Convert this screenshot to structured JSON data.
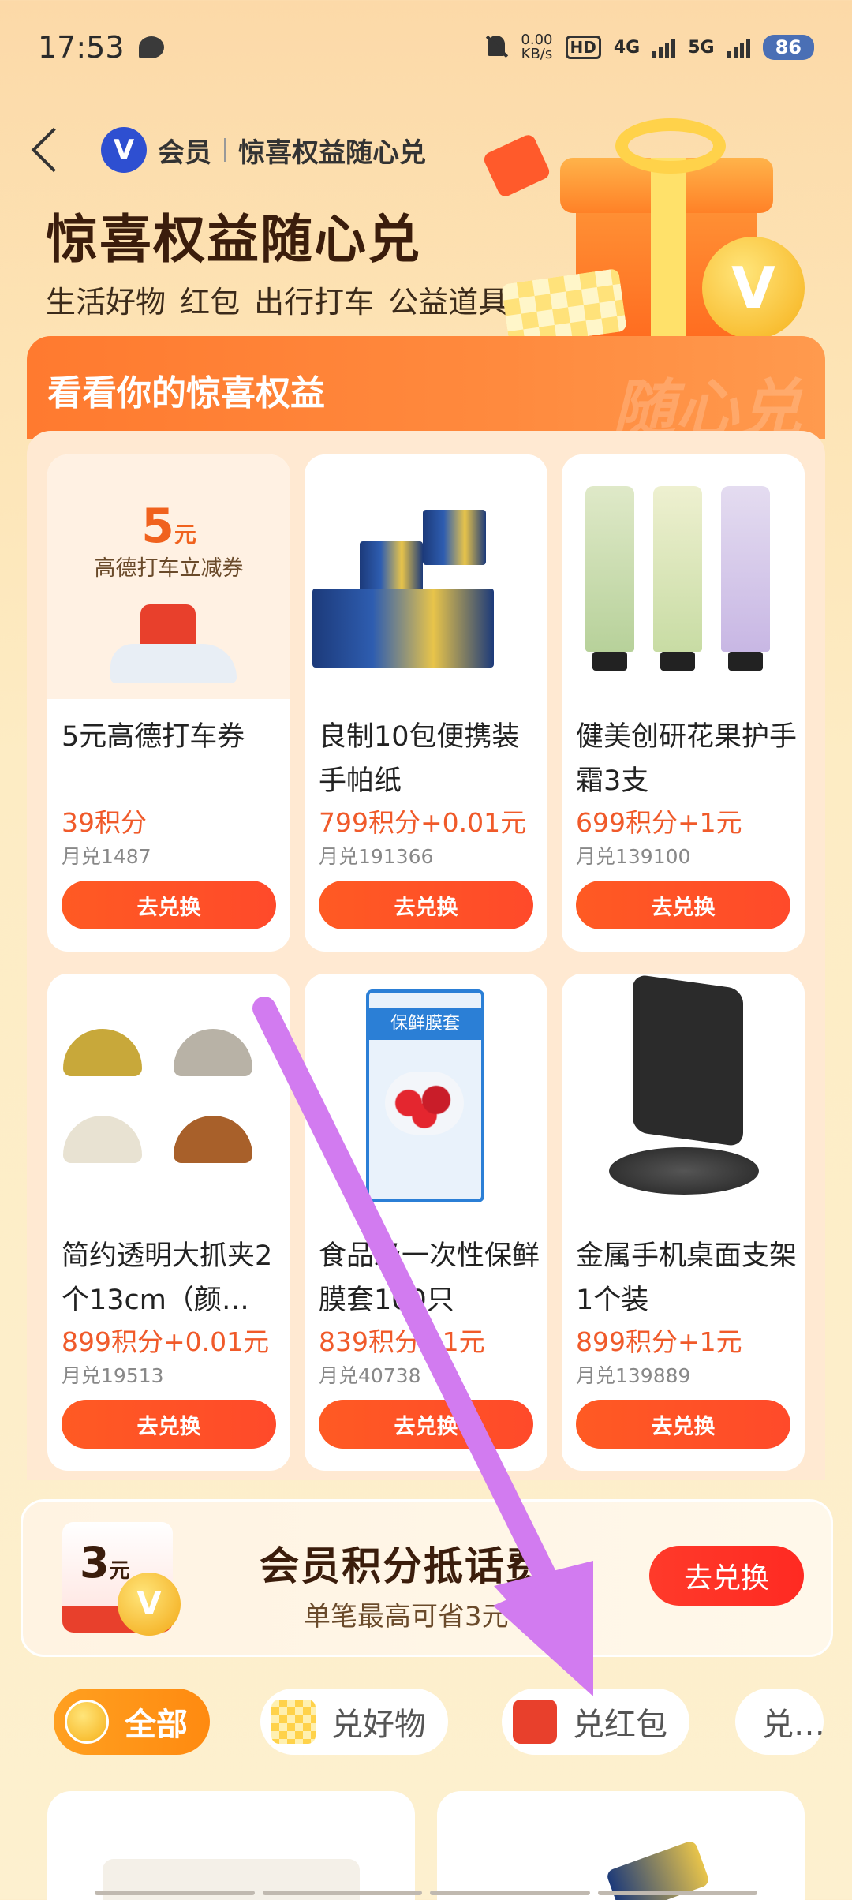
{
  "status_bar": {
    "time": "17:53",
    "net_speed_value": "0.00",
    "net_speed_unit": "KB/s",
    "hd": "HD",
    "sim1": "4G",
    "sim2": "5G",
    "battery": "86"
  },
  "header": {
    "back_icon": "chevron-left-icon",
    "brand": "会员",
    "page_name": "惊喜权益随心兑",
    "title": "惊喜权益随心兑",
    "subtitle": "生活好物 红包 出行打车 公益道具"
  },
  "panel": {
    "title": "看看你的惊喜权益",
    "watermark": "随心兑"
  },
  "products": [
    {
      "name": "5元高德打车券",
      "price": "39积分",
      "sold": "月兑1487",
      "button": "去兑换",
      "img_amount": "5",
      "img_unit": "元",
      "img_desc": "高德打车立减券"
    },
    {
      "name": "良制10包便携装手帕纸",
      "price": "799积分+0.01元",
      "sold": "月兑191366",
      "button": "去兑换"
    },
    {
      "name": "健美创研花果护手霜3支",
      "price": "699积分+1元",
      "sold": "月兑139100",
      "button": "去兑换"
    },
    {
      "name": "简约透明大抓夹2个13cm（颜…",
      "price": "899积分+0.01元",
      "sold": "月兑19513",
      "button": "去兑换"
    },
    {
      "name": "食品级一次性保鲜膜套100只",
      "price": "839积分+1元",
      "sold": "月兑40738",
      "button": "去兑换",
      "img_label": "保鲜膜套"
    },
    {
      "name": "金属手机桌面支架1个装",
      "price": "899积分+1元",
      "sold": "月兑139889",
      "button": "去兑换"
    }
  ],
  "banner": {
    "coupon_amount": "3",
    "coupon_unit": "元",
    "title": "会员积分抵话费",
    "subtitle": "单笔最高可省3元",
    "button": "去兑换"
  },
  "tabs": [
    {
      "label": "全部",
      "active": true
    },
    {
      "label": "兑好物",
      "active": false
    },
    {
      "label": "兑红包",
      "active": false
    },
    {
      "label": "兑…",
      "active": false
    }
  ],
  "colors": {
    "accent": "#ff5a23",
    "price": "#f05a2a",
    "annotation_arrow": "#d27bf0"
  }
}
